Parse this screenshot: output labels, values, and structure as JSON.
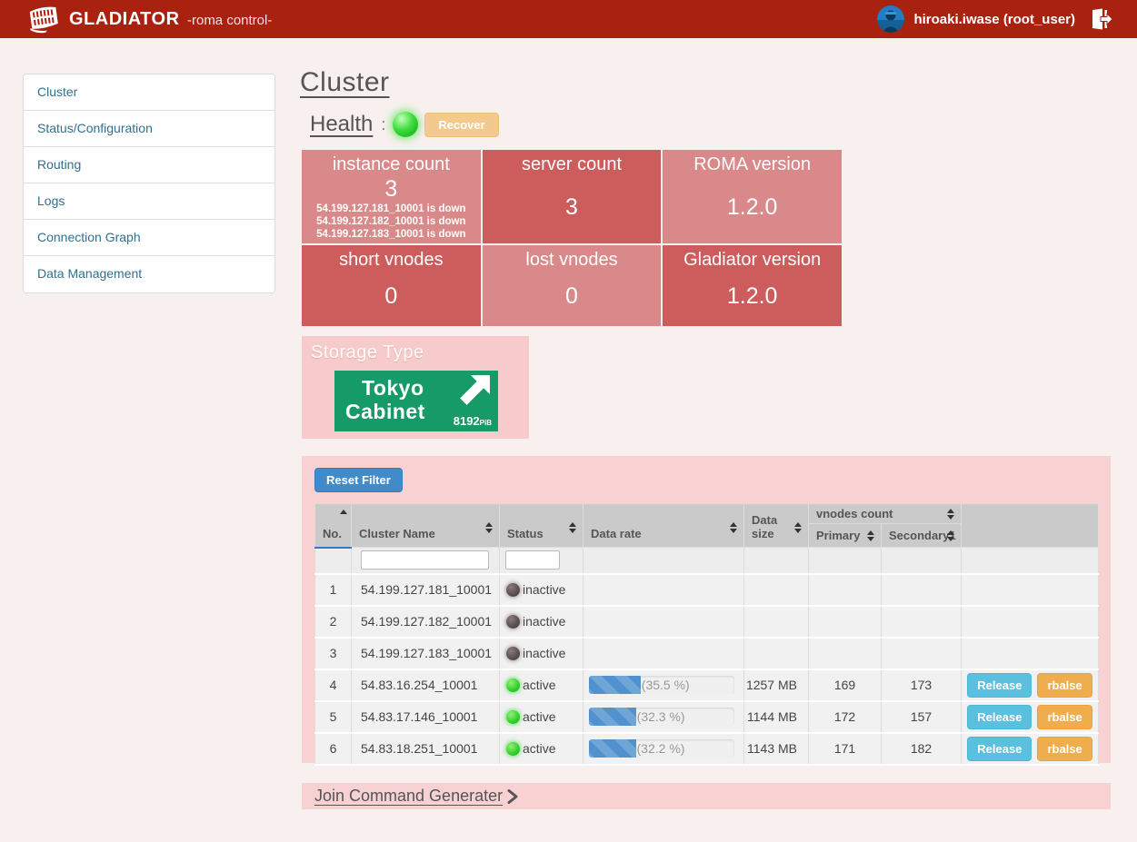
{
  "colors": {
    "header_bg": "#a8220f",
    "tile_light": "#d98989",
    "tile_dark": "#cd5c5c",
    "panel_pink": "#f8d2d2",
    "health_ok": "#2ed32e",
    "reset_button": "#428bca",
    "release_button": "#5bc0de",
    "rbalse_button": "#f0ad4e",
    "storage_logo_green": "#169a67"
  },
  "header": {
    "brand": "GLADIATOR",
    "subtitle": "-roma control-",
    "user": "hiroaki.iwase (root_user)"
  },
  "sidebar": {
    "items": [
      {
        "label": "Cluster"
      },
      {
        "label": "Status/Configuration"
      },
      {
        "label": "Routing"
      },
      {
        "label": "Logs"
      },
      {
        "label": "Connection Graph"
      },
      {
        "label": "Data Management"
      }
    ]
  },
  "main": {
    "title": "Cluster",
    "health": {
      "label": "Health",
      "separator": ":",
      "status": "ok",
      "recover_label": "Recover"
    },
    "stats": [
      {
        "label": "instance count",
        "value": "3",
        "notes": [
          "54.199.127.181_10001 is down",
          "54.199.127.182_10001 is down",
          "54.199.127.183_10001 is down"
        ]
      },
      {
        "label": "server count",
        "value": "3"
      },
      {
        "label": "ROMA version",
        "value": "1.2.0"
      },
      {
        "label": "short vnodes",
        "value": "0"
      },
      {
        "label": "lost vnodes",
        "value": "0"
      },
      {
        "label": "Gladiator version",
        "value": "1.2.0"
      }
    ],
    "storage": {
      "label": "Storage Type",
      "logo_line1": "Tokyo",
      "logo_line2": "Cabinet",
      "logo_size": "8192",
      "logo_size_unit": "PiB"
    },
    "table": {
      "reset_button": "Reset Filter",
      "columns": {
        "no": "No.",
        "cluster_name": "Cluster Name",
        "status": "Status",
        "data_rate": "Data rate",
        "data_size": "Data size",
        "vnodes_group": "vnodes count",
        "primary": "Primary",
        "secondary1": "Secondary1"
      },
      "actions": {
        "release": "Release",
        "rbalse": "rbalse"
      },
      "rows": [
        {
          "no": "1",
          "name": "54.199.127.181_10001",
          "status": "inactive"
        },
        {
          "no": "2",
          "name": "54.199.127.182_10001",
          "status": "inactive"
        },
        {
          "no": "3",
          "name": "54.199.127.183_10001",
          "status": "inactive"
        },
        {
          "no": "4",
          "name": "54.83.16.254_10001",
          "status": "active",
          "rate_pct": 35.5,
          "rate_label": "(35.5 %)",
          "size": "1257 MB",
          "primary": "169",
          "secondary1": "173"
        },
        {
          "no": "5",
          "name": "54.83.17.146_10001",
          "status": "active",
          "rate_pct": 32.3,
          "rate_label": "(32.3 %)",
          "size": "1144 MB",
          "primary": "172",
          "secondary1": "157"
        },
        {
          "no": "6",
          "name": "54.83.18.251_10001",
          "status": "active",
          "rate_pct": 32.2,
          "rate_label": "(32.2 %)",
          "size": "1143 MB",
          "primary": "171",
          "secondary1": "182"
        }
      ]
    },
    "join_link": "Join Command Generater"
  }
}
